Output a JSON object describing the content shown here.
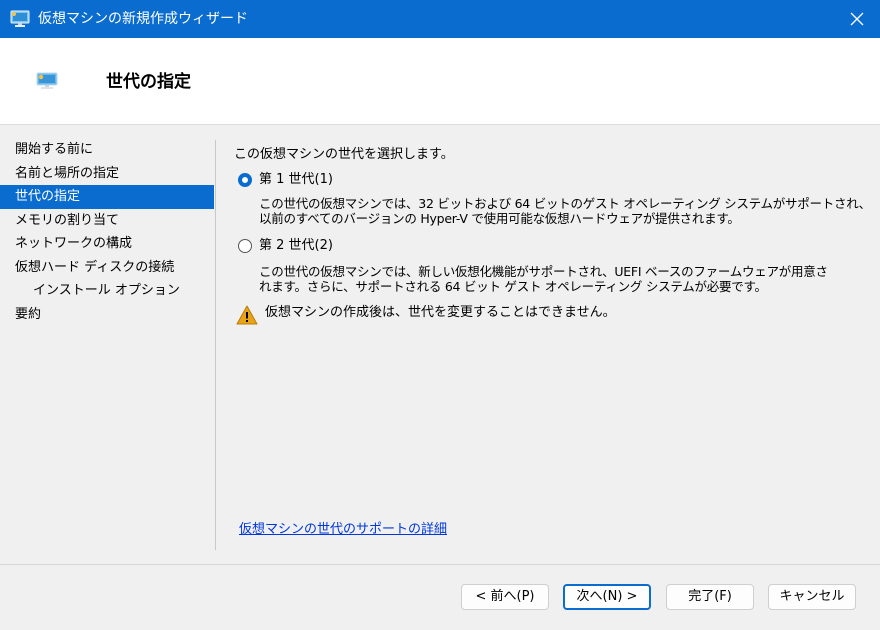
{
  "window": {
    "title": "仮想マシンの新規作成ウィザード"
  },
  "header": {
    "title": "世代の指定"
  },
  "nav": {
    "items": [
      {
        "label": "開始する前に"
      },
      {
        "label": "名前と場所の指定"
      },
      {
        "label": "世代の指定"
      },
      {
        "label": "メモリの割り当て"
      },
      {
        "label": "ネットワークの構成"
      },
      {
        "label": "仮想ハード ディスクの接続"
      },
      {
        "label": "インストール オプション"
      },
      {
        "label": "要約"
      }
    ]
  },
  "content": {
    "intro": "この仮想マシンの世代を選択します。",
    "options": [
      {
        "label": "第 1 世代(1)",
        "checked": true,
        "desc_lines": [
          "この世代の仮想マシンでは、32 ビットおよび 64 ビットのゲスト オペレーティング システムがサポートされ、",
          "以前のすべてのバージョンの Hyper-V で使用可能な仮想ハードウェアが提供されます。"
        ]
      },
      {
        "label": "第 2 世代(2)",
        "checked": false,
        "desc_lines": [
          "この世代の仮想マシンでは、新しい仮想化機能がサポートされ、UEFI ベースのファームウェアが用意さ",
          "れます。さらに、サポートされる 64 ビット ゲスト オペレーティング システムが必要です。"
        ]
      }
    ],
    "warning": "仮想マシンの作成後は、世代を変更することはできません。",
    "help_link": "仮想マシンの世代のサポートの詳細"
  },
  "buttons": {
    "back": "< 前へ(P)",
    "next": "次へ(N) >",
    "finish": "完了(F)",
    "cancel": "キャンセル"
  },
  "colors": {
    "accent": "#0a6ccf",
    "link": "#0037da",
    "warning": "#e8a317"
  }
}
